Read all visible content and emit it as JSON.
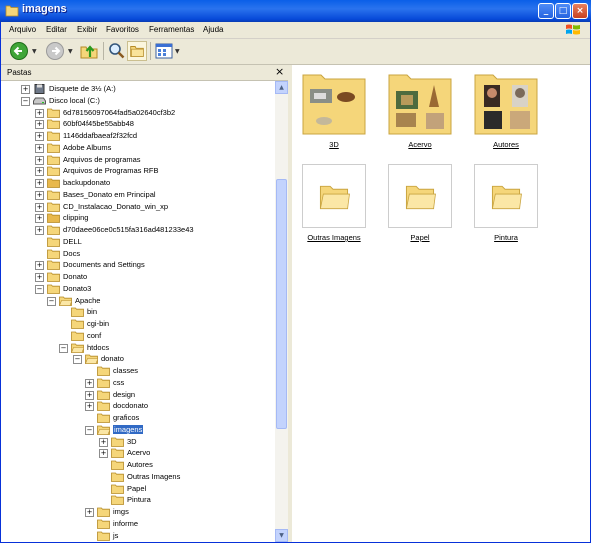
{
  "window": {
    "title": "imagens"
  },
  "menu": [
    "Arquivo",
    "Editar",
    "Exibir",
    "Favoritos",
    "Ferramentas",
    "Ajuda"
  ],
  "toolbar": {
    "back": "back-icon",
    "forward": "forward-icon",
    "up": "up-folder-icon",
    "search": "search-icon",
    "folders": "folders-icon",
    "views": "views-icon"
  },
  "left_pane": {
    "title": "Pastas",
    "close": "×"
  },
  "tree": [
    {
      "label": "Disquete de 3½ (A:)",
      "level": 1,
      "pm": "+",
      "icon": "floppy"
    },
    {
      "label": "Disco local (C:)",
      "level": 1,
      "pm": "−",
      "icon": "drive"
    },
    {
      "label": "6d78156097064fad5a02640cf3b2",
      "level": 2,
      "pm": "+",
      "icon": "folder"
    },
    {
      "label": "60bf04f45be55abb48",
      "level": 2,
      "pm": "+",
      "icon": "folder"
    },
    {
      "label": "1146ddafbaeaf2f32fcd",
      "level": 2,
      "pm": "+",
      "icon": "folder"
    },
    {
      "label": "Adobe Albums",
      "level": 2,
      "pm": "+",
      "icon": "folder"
    },
    {
      "label": "Arquivos de programas",
      "level": 2,
      "pm": "+",
      "icon": "folder"
    },
    {
      "label": "Arquivos de Programas RFB",
      "level": 2,
      "pm": "+",
      "icon": "folder"
    },
    {
      "label": "backupdonato",
      "level": 2,
      "pm": "+",
      "icon": "folder-special"
    },
    {
      "label": "Bases_Donato em Principal",
      "level": 2,
      "pm": "+",
      "icon": "folder"
    },
    {
      "label": "CD_Instalacao_Donato_win_xp",
      "level": 2,
      "pm": "+",
      "icon": "folder"
    },
    {
      "label": "clipping",
      "level": 2,
      "pm": "+",
      "icon": "folder-special"
    },
    {
      "label": "d70daee06ce0c515fa316ad481233e43",
      "level": 2,
      "pm": "+",
      "icon": "folder"
    },
    {
      "label": "DELL",
      "level": 2,
      "pm": "",
      "icon": "folder"
    },
    {
      "label": "Docs",
      "level": 2,
      "pm": "",
      "icon": "folder"
    },
    {
      "label": "Documents and Settings",
      "level": 2,
      "pm": "+",
      "icon": "folder"
    },
    {
      "label": "Donato",
      "level": 2,
      "pm": "+",
      "icon": "folder"
    },
    {
      "label": "Donato3",
      "level": 2,
      "pm": "−",
      "icon": "folder"
    },
    {
      "label": "Apache",
      "level": 3,
      "pm": "−",
      "icon": "folder-open"
    },
    {
      "label": "bin",
      "level": 4,
      "pm": "",
      "icon": "folder"
    },
    {
      "label": "cgi-bin",
      "level": 4,
      "pm": "",
      "icon": "folder"
    },
    {
      "label": "conf",
      "level": 4,
      "pm": "",
      "icon": "folder"
    },
    {
      "label": "htdocs",
      "level": 4,
      "pm": "−",
      "icon": "folder-open"
    },
    {
      "label": "donato",
      "level": 5,
      "pm": "−",
      "icon": "folder-open"
    },
    {
      "label": "classes",
      "level": 6,
      "pm": "",
      "icon": "folder"
    },
    {
      "label": "css",
      "level": 6,
      "pm": "+",
      "icon": "folder"
    },
    {
      "label": "design",
      "level": 6,
      "pm": "+",
      "icon": "folder"
    },
    {
      "label": "docdonato",
      "level": 6,
      "pm": "+",
      "icon": "folder"
    },
    {
      "label": "graficos",
      "level": 6,
      "pm": "",
      "icon": "folder"
    },
    {
      "label": "imagens",
      "level": 6,
      "pm": "−",
      "icon": "folder-open",
      "selected": true
    },
    {
      "label": "3D",
      "level": 7,
      "pm": "+",
      "icon": "folder"
    },
    {
      "label": "Acervo",
      "level": 7,
      "pm": "+",
      "icon": "folder"
    },
    {
      "label": "Autores",
      "level": 7,
      "pm": "",
      "icon": "folder"
    },
    {
      "label": "Outras Imagens",
      "level": 7,
      "pm": "",
      "icon": "folder"
    },
    {
      "label": "Papel",
      "level": 7,
      "pm": "",
      "icon": "folder"
    },
    {
      "label": "Pintura",
      "level": 7,
      "pm": "",
      "icon": "folder"
    },
    {
      "label": "imgs",
      "level": 6,
      "pm": "+",
      "icon": "folder"
    },
    {
      "label": "informe",
      "level": 6,
      "pm": "",
      "icon": "folder"
    },
    {
      "label": "js",
      "level": 6,
      "pm": "",
      "icon": "folder"
    }
  ],
  "folders": [
    {
      "label": "3D",
      "preview": true
    },
    {
      "label": "Acervo",
      "preview": true
    },
    {
      "label": "Autores",
      "preview": true
    },
    {
      "label": "Outras Imagens",
      "preview": false
    },
    {
      "label": "Papel",
      "preview": false
    },
    {
      "label": "Pintura",
      "preview": false
    }
  ],
  "colors": {
    "title_bar": "#0a5fe8",
    "selection": "#316ac5",
    "folder": "#f5d67a"
  }
}
